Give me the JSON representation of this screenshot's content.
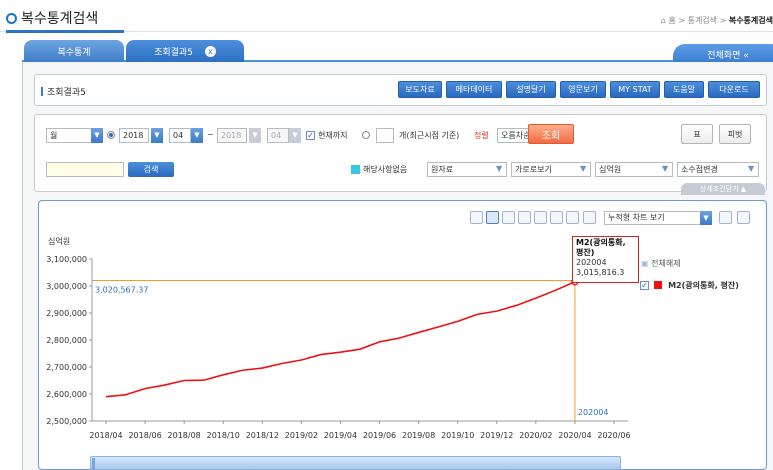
{
  "page": {
    "title": "복수통계검색",
    "breadcrumb": {
      "home": "홈",
      "sep1": ">",
      "level1": "통계검색",
      "sep2": ">",
      "current": "복수통계검색"
    }
  },
  "tabs": [
    {
      "label": "복수통계"
    },
    {
      "label": "조회결과5",
      "close": "x"
    }
  ],
  "fullscreen_label": "전체화면 «",
  "results_panel": {
    "label": "조회결과5",
    "buttons": [
      "보도자료",
      "메타데이터",
      "설명달기",
      "영문보기",
      "MY STAT",
      "도움말",
      "다운로드"
    ]
  },
  "query": {
    "period": "월",
    "start_year": "2018",
    "start_month": "04",
    "tilde": "~",
    "end_year": "2018",
    "end_month": "04",
    "until_now": "현재까지",
    "recent_suffix": "개(최근시점 기준)",
    "sort_label": "정렬",
    "sort_value": "오름차순",
    "search_button": "조회",
    "table_button": "표",
    "pivot_button": "피벗",
    "search_input_value": "",
    "find_button": "검색",
    "no_data": "해당사항없음",
    "source": "원자료",
    "orientation": "가로로보기",
    "unit": "십억원",
    "decimal": "소수점변경",
    "detail_toggle": "상세조건닫기 ▲"
  },
  "chart_toolbar": {
    "chart_view": "누적형 차트 보기",
    "icons": [
      "table-icon",
      "line-chart-icon",
      "area-chart-icon",
      "bar-chart-icon",
      "column-chart-icon",
      "hbar-chart-icon",
      "stacked-bar-icon",
      "save-icon",
      "print-icon"
    ]
  },
  "chart_data": {
    "type": "line",
    "ylabel": "십억원",
    "ylim": [
      2500000,
      3100000
    ],
    "yticks": [
      "3,100,000",
      "3,000,000",
      "2,900,000",
      "2,800,000",
      "2,700,000",
      "2,600,000",
      "2,500,000"
    ],
    "xticks": [
      "2018/04",
      "2018/06",
      "2018/08",
      "2018/10",
      "2018/12",
      "2019/02",
      "2019/04",
      "2019/06",
      "2019/08",
      "2019/10",
      "2019/12",
      "2020/02",
      "2020/04",
      "2020/06"
    ],
    "series": [
      {
        "name": "M2(광의통화, 평잔)",
        "color": "#ef1111",
        "x": [
          "2018/04",
          "2018/05",
          "2018/06",
          "2018/07",
          "2018/08",
          "2018/09",
          "2018/10",
          "2018/11",
          "2018/12",
          "2019/01",
          "2019/02",
          "2019/03",
          "2019/04",
          "2019/05",
          "2019/06",
          "2019/07",
          "2019/08",
          "2019/09",
          "2019/10",
          "2019/11",
          "2019/12",
          "2020/01",
          "2020/02",
          "2020/03",
          "2020/04"
        ],
        "values": [
          2590000,
          2597000,
          2620000,
          2633000,
          2650000,
          2651000,
          2671000,
          2688000,
          2696000,
          2713000,
          2726000,
          2746000,
          2755000,
          2766000,
          2793000,
          2807000,
          2828000,
          2848000,
          2869000,
          2895000,
          2907000,
          2928000,
          2955000,
          2984000,
          3015816.3
        ]
      }
    ],
    "crosshair": {
      "x_label": "202004",
      "y_label": "3,020,567.37"
    },
    "tooltip": {
      "title": "M2(광의통화, 평잔)",
      "period": "202004",
      "value": "3,015,816.3"
    },
    "legend": {
      "select_all": "전체해제",
      "items": [
        "M2(광의통화, 평잔)"
      ]
    }
  }
}
